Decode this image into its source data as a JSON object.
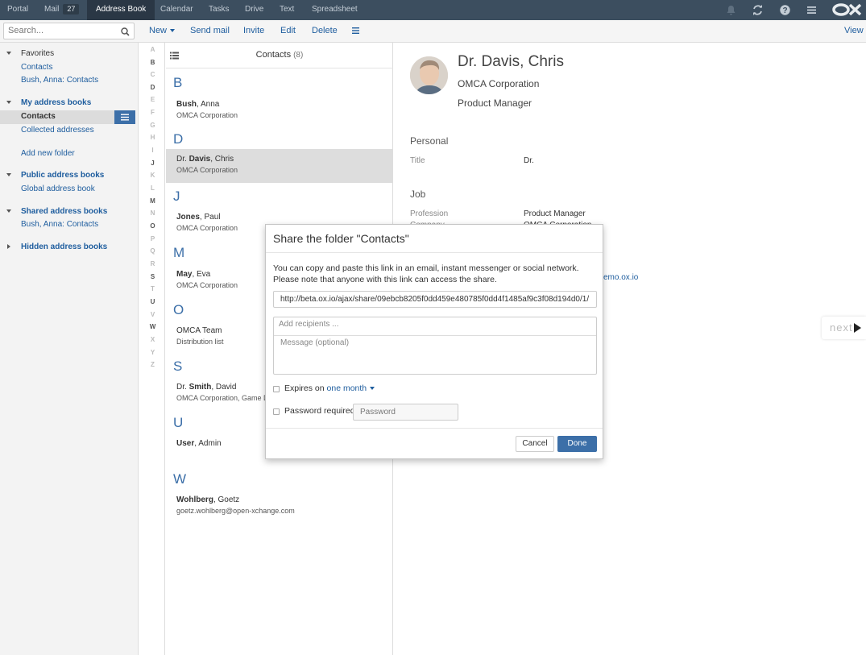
{
  "topbar": {
    "apps": [
      "Portal",
      "Mail",
      "Address Book",
      "Calendar",
      "Tasks",
      "Drive",
      "Text",
      "Spreadsheet"
    ],
    "mail_badge": "27",
    "active_app": "Address Book",
    "icons": [
      "bell-icon",
      "refresh-icon",
      "help-icon",
      "menu-icon",
      "ox-logo"
    ],
    "logo_text": "OX"
  },
  "toolbar": {
    "search_placeholder": "Search...",
    "new": "New",
    "send_mail": "Send mail",
    "invite": "Invite",
    "edit": "Edit",
    "delete": "Delete",
    "view": "View"
  },
  "sidebar": {
    "favorites": "Favorites",
    "fav_contacts": "Contacts",
    "fav_bush": "Bush, Anna: Contacts",
    "my_books": "My address books",
    "my_contacts": "Contacts",
    "collected": "Collected addresses",
    "add_folder": "Add new folder",
    "public_books": "Public address books",
    "global_book": "Global address book",
    "shared_books": "Shared address books",
    "shared_bush": "Bush, Anna: Contacts",
    "hidden_books": "Hidden address books"
  },
  "alphabet": [
    "A",
    "B",
    "C",
    "D",
    "E",
    "F",
    "G",
    "H",
    "I",
    "J",
    "K",
    "L",
    "M",
    "N",
    "O",
    "P",
    "Q",
    "R",
    "S",
    "T",
    "U",
    "V",
    "W",
    "X",
    "Y",
    "Z"
  ],
  "list": {
    "title": "Contacts",
    "count": "(8)",
    "letters": {
      "b": "B",
      "d": "D",
      "j": "J",
      "m": "M",
      "o": "O",
      "s": "S",
      "u": "U",
      "w": "W"
    },
    "entries": [
      {
        "prefix": "",
        "last": "Bush",
        "first": ", Anna",
        "sub": "OMCA Corporation"
      },
      {
        "prefix": "Dr. ",
        "last": "Davis",
        "first": ", Chris",
        "sub": "OMCA Corporation"
      },
      {
        "prefix": "",
        "last": "Jones",
        "first": ", Paul",
        "sub": "OMCA Corporation"
      },
      {
        "prefix": "",
        "last": "May",
        "first": ", Eva",
        "sub": "OMCA Corporation"
      },
      {
        "prefix": "",
        "last": "",
        "first": "OMCA Team",
        "sub": "Distribution list"
      },
      {
        "prefix": "Dr. ",
        "last": "Smith",
        "first": ", David",
        "sub": "OMCA Corporation, Game D"
      },
      {
        "prefix": "",
        "last": "User",
        "first": ", Admin",
        "sub": ""
      },
      {
        "prefix": "",
        "last": "Wohlberg",
        "first": ", Goetz",
        "sub": "goetz.wohlberg@open-xchange.com"
      }
    ]
  },
  "detail": {
    "name": "Dr. Davis, Chris",
    "company": "OMCA Corporation",
    "position": "Product Manager",
    "personal": "Personal",
    "title_label": "Title",
    "title_value": "Dr.",
    "job": "Job",
    "profession_label": "Profession",
    "profession_value": "Product Manager",
    "company_label": "Company",
    "company_value": "OMCA Corporation",
    "email_partial": "emo.ox.io",
    "next": "next"
  },
  "dialog": {
    "title": "Share the folder \"Contacts\"",
    "text": "You can copy and paste this link in an email, instant messenger or social network. Please note that anyone with this link can access the share.",
    "url": "http://beta.ox.io/ajax/share/09ebcb8205f0dd459e480785f0dd4f1485af9c3f08d194d0/1/",
    "recipients_placeholder": "Add recipients ...",
    "message_placeholder": "Message (optional)",
    "expires_label": "Expires on",
    "expires_value": "one month",
    "password_required": "Password required",
    "password_placeholder": "Password",
    "cancel": "Cancel",
    "done": "Done"
  },
  "colors": {
    "accent": "#3c6fa8",
    "topbar": "#3c4e5f",
    "link": "#1e5d9e"
  }
}
